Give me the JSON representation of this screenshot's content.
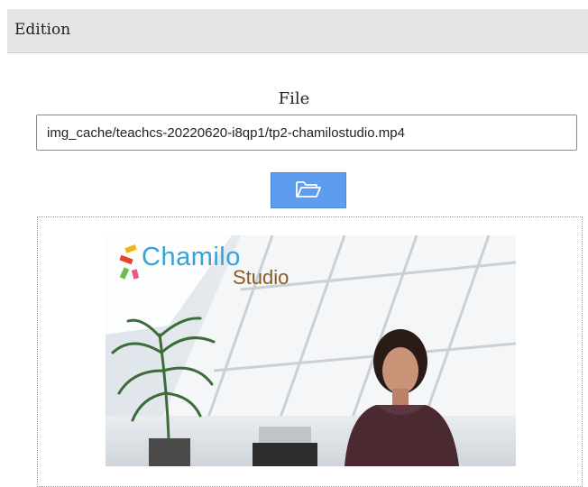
{
  "header": {
    "title": "Edition"
  },
  "file": {
    "label": "File",
    "path": "img_cache/teachcs-20220620-i8qp1/tp2-chamilostudio.mp4",
    "browse_icon": "folder-open-icon"
  },
  "preview": {
    "logo_main": "Chamilo",
    "logo_sub": "Studio"
  },
  "colors": {
    "header_bg": "#e6e6e6",
    "button_bg": "#5e9cf0",
    "logo_blue": "#3aa0d8",
    "logo_brown": "#8a5a25"
  }
}
